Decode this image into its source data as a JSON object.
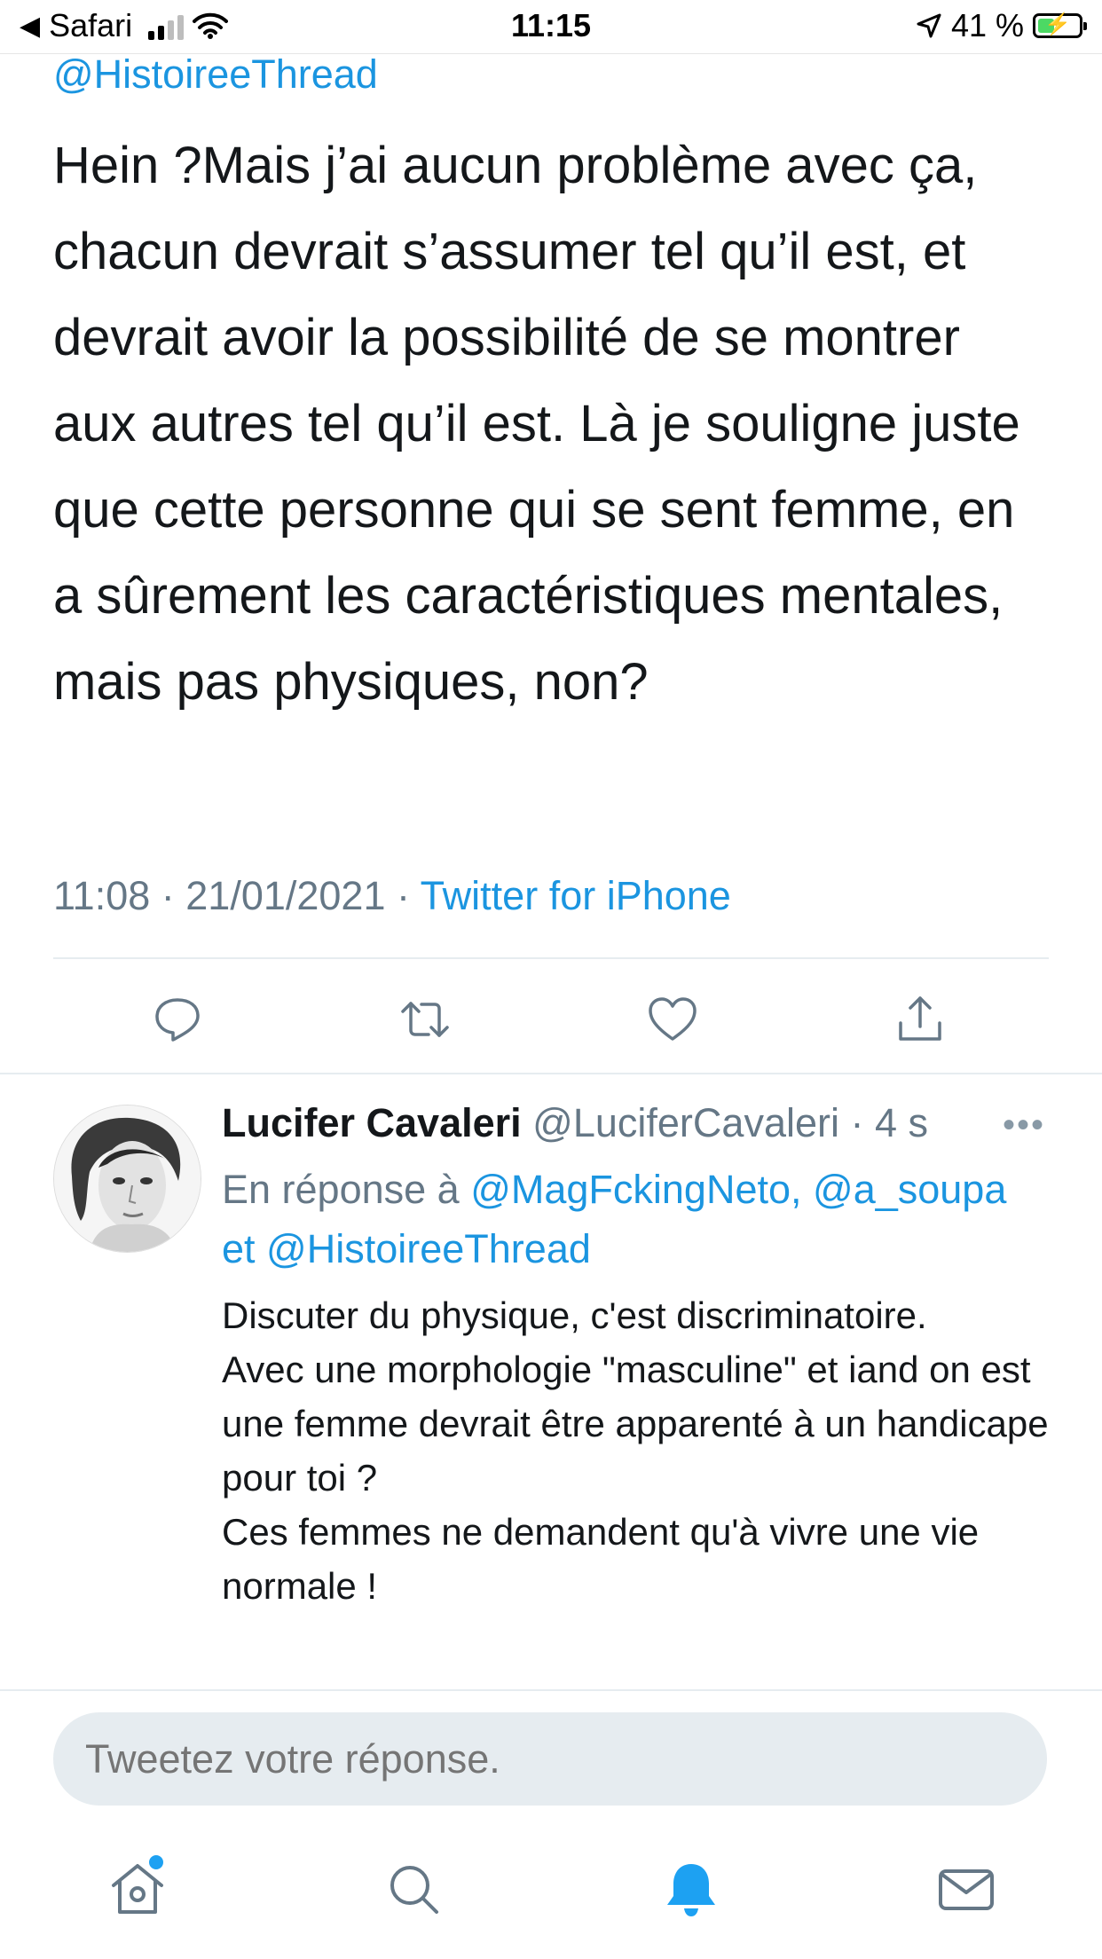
{
  "status_bar": {
    "back_app": "Safari",
    "time": "11:15",
    "battery": "41 %",
    "battery_level": 0.41
  },
  "tweet": {
    "mention_top": "@HistoireeThread",
    "text": "Hein ?Mais j’ai aucun problème avec ça, chacun devrait s’assumer tel qu’il est, et devrait avoir la possibilité de se montrer aux autres tel qu’il est. Là je souligne juste que cette personne qui se sent femme, en a sûrement les caractéristiques mentales, mais pas physiques, non?",
    "timestamp": "11:08 · 21/01/2021 · ",
    "source": "Twitter for iPhone",
    "actions": [
      "reply-icon",
      "retweet-icon",
      "like-icon",
      "share-icon"
    ]
  },
  "reply": {
    "name": "Lucifer Cavaleri",
    "handle": "@LuciferCavaleri",
    "time": " · 4 s",
    "more": "•••",
    "reply_to_prefix": "En réponse à ",
    "reply_to_users": "@MagFckingNeto, @a_soupa",
    "reply_to_and": "et ",
    "reply_to_last": "@HistoireeThread",
    "body_lines": [
      "Discuter du physique, c'est discriminatoire.",
      "Avec une morphologie \"masculine\" et iand on est une femme devrait être apparenté à un handicape pour toi ?",
      "Ces femmes ne demandent qu'à vivre une vie normale !"
    ]
  },
  "compose": {
    "placeholder": "Tweetez votre réponse."
  },
  "tab_bar": {
    "tabs": [
      "home-icon",
      "search-icon",
      "notifications-icon",
      "messages-icon"
    ],
    "active": "notifications-icon"
  },
  "colors": {
    "accent": "#1da1f2",
    "link": "#1b95e0",
    "secondary_text": "#657786",
    "divider": "#e6ecf0"
  }
}
